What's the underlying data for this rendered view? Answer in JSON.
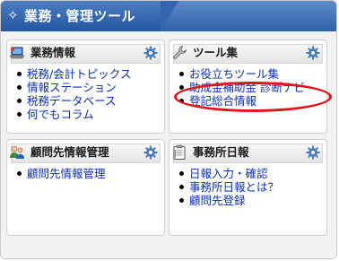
{
  "header": {
    "icon": "diamond-sparkle-icon",
    "title": "業務・管理ツール"
  },
  "panels": [
    {
      "icon": "laptop-icon",
      "title": "業務情報",
      "settings_icon": "gear-icon",
      "items": [
        "税務/会計トピックス",
        "情報ステーション",
        "税務データベース",
        "何でもコラム"
      ]
    },
    {
      "icon": "wrench-icon",
      "title": "ツール集",
      "settings_icon": "gear-icon",
      "items": [
        "お役立ちツール集",
        "助成金補助金 診断ナビ",
        "登記総合情報"
      ]
    },
    {
      "icon": "users-icon",
      "title": "顧問先情報管理",
      "settings_icon": "gear-icon",
      "items": [
        "顧問先情報管理"
      ]
    },
    {
      "icon": "clipboard-icon",
      "title": "事務所日報",
      "settings_icon": "gear-icon",
      "items": [
        "日報入力・確認",
        "事務所日報とは？",
        "顧問先登録"
      ]
    }
  ],
  "colors": {
    "header_blue": "#2f62a6",
    "link_blue": "#0a2fb5",
    "highlight_red": "#e1141b"
  }
}
